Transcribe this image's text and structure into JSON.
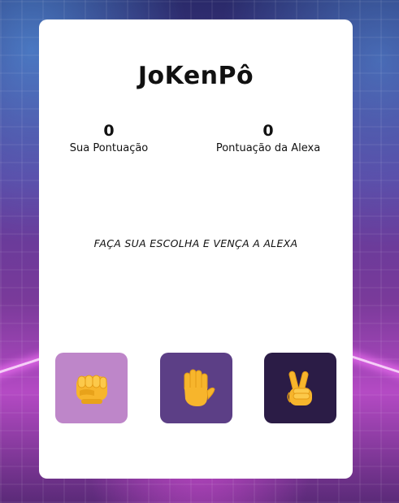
{
  "app": {
    "title": "JoKenPô"
  },
  "scores": {
    "user": {
      "value": "0",
      "label": "Sua Pontuação"
    },
    "alexa": {
      "value": "0",
      "label": "Pontuação da Alexa"
    }
  },
  "message": "FAÇA SUA ESCOLHA E VENÇA A ALEXA",
  "choices": [
    {
      "name": "rock",
      "icon": "fist-icon",
      "color": "#be86c9"
    },
    {
      "name": "paper",
      "icon": "raised-hand-icon",
      "color": "#5c3f86"
    },
    {
      "name": "scissors",
      "icon": "victory-hand-icon",
      "color": "#2b1c46"
    }
  ],
  "colors": {
    "card": "#ffffff",
    "text": "#111111",
    "emoji": "#f7b52c"
  }
}
